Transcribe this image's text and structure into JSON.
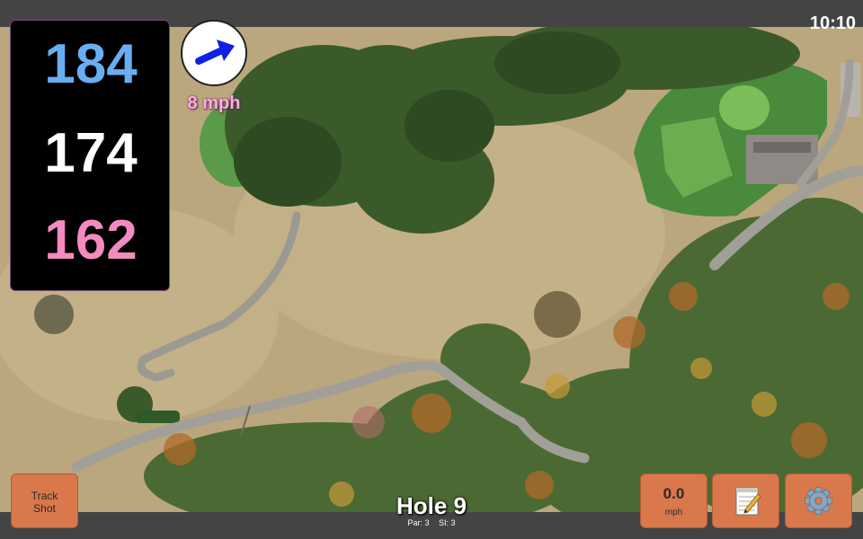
{
  "status": {
    "time": "10:10"
  },
  "distances": {
    "back": "184",
    "middle": "174",
    "front": "162"
  },
  "wind": {
    "speed": "8 mph",
    "icon": "wind-arrow-icon"
  },
  "buttons": {
    "track_line1": "Track",
    "track_line2": "Shot",
    "speed_value": "0.0",
    "speed_unit": "mph",
    "notes_icon": "notepad-icon",
    "settings_icon": "gear-icon"
  },
  "hole": {
    "title": "Hole 9",
    "par": "Par: 3",
    "si": "SI: 3"
  },
  "colors": {
    "back": "#6aaef2",
    "middle": "#ffffff",
    "front": "#f38ac0",
    "button": "#d9784b",
    "wind_text": "#f7b0dc"
  }
}
